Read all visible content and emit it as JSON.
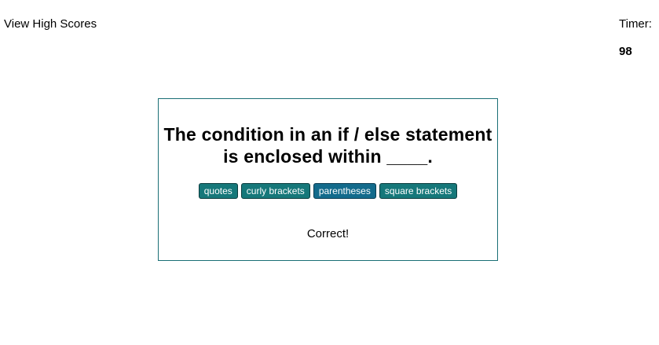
{
  "header": {
    "high_scores_link": "View High Scores",
    "timer_label": "Timer:",
    "timer_value": "98"
  },
  "quiz": {
    "question": "The condition in an if / else statement is enclosed within ____.",
    "answers": [
      {
        "label": "quotes",
        "selected": false
      },
      {
        "label": "curly brackets",
        "selected": false
      },
      {
        "label": "parentheses",
        "selected": true
      },
      {
        "label": "square brackets",
        "selected": false
      }
    ],
    "feedback": "Correct!"
  },
  "colors": {
    "button_bg": "#16787a",
    "button_selected_bg": "#136b8c",
    "card_border": "#1a6f75"
  }
}
